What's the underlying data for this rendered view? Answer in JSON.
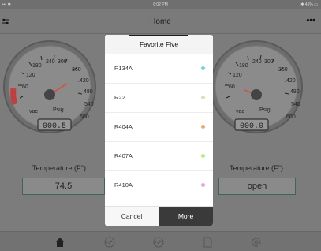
{
  "status": {
    "left": "••• ✱",
    "time": "6:02 PM",
    "right": "✱ 45% ▭"
  },
  "nav": {
    "title": "Home",
    "more": "•••"
  },
  "gauges": {
    "left": {
      "ticks": [
        "60",
        "120",
        "180",
        "240",
        "300",
        "360",
        "420",
        "480",
        "540",
        "600"
      ],
      "vac": "vac",
      "unit": "Psig",
      "readout": "000.5"
    },
    "right": {
      "ticks": [
        "60",
        "120",
        "180",
        "240",
        "300",
        "360",
        "420",
        "480",
        "540",
        "600"
      ],
      "vac": "vac",
      "unit": "Psig",
      "readout": "000.0"
    }
  },
  "temps": {
    "left": {
      "label": "Temperature (F°)",
      "value": "74.5"
    },
    "right": {
      "label": "Temperature (F°)",
      "value": "open"
    }
  },
  "dialog": {
    "title": "Favorite Five",
    "items": [
      {
        "label": "R134A",
        "color": "#6fd3e6"
      },
      {
        "label": "R22",
        "color": "#e8dcb5"
      },
      {
        "label": "R404A",
        "color": "#f0a36a"
      },
      {
        "label": "R407A",
        "color": "#b7ef7f"
      },
      {
        "label": "R410A",
        "color": "#f39be8"
      }
    ],
    "cancel": "Cancel",
    "more": "More"
  },
  "tabs": [
    "home-icon",
    "trend-icon",
    "trend-icon-2",
    "document-icon",
    "settings-icon"
  ]
}
